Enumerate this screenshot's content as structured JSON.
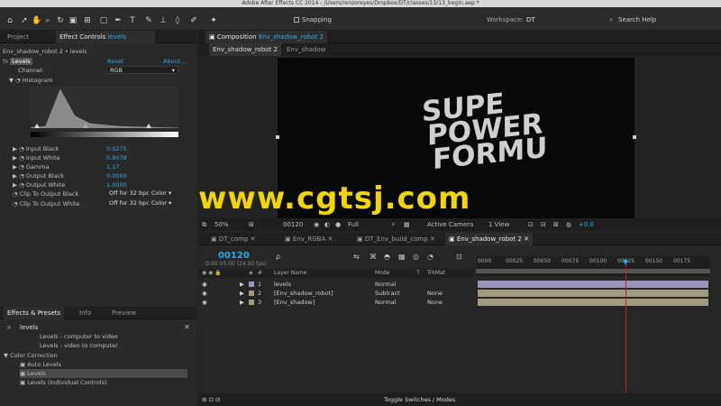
{
  "window_title": "Adobe After Effects CC 2014 - /Users/renzoreyes/Dropbox/DT/classes/13/13_begin.aep *",
  "toolbar": {
    "snapping_label": "Snapping",
    "workspace_label": "Workspace:",
    "workspace_value": "DT",
    "search_help_placeholder": "Search Help"
  },
  "project_panel": {
    "tab_project": "Project",
    "tab_effect_controls": "Effect Controls",
    "tab_effect_controls_layer": "levels",
    "header": "Env_shadow_robot 2 • levels",
    "effect_name": "Levels",
    "reset_label": "Reset",
    "about_label": "About...",
    "channel_label": "Channel:",
    "channel_value": "RGB",
    "histogram_label": "Histogram",
    "properties": [
      {
        "label": "Input Black",
        "value": "0.0275"
      },
      {
        "label": "Input White",
        "value": "0.8078"
      },
      {
        "label": "Gamma",
        "value": "1.17"
      },
      {
        "label": "Output Black",
        "value": "0.0000"
      },
      {
        "label": "Output White",
        "value": "1.0000"
      }
    ],
    "clip_black_label": "Clip To Output Black",
    "clip_black_value": "Off for 32 bpc Color",
    "clip_white_label": "Clip To Output White",
    "clip_white_value": "Off for 32 bpc Color"
  },
  "effects_presets": {
    "tab_effects": "Effects & Presets",
    "tab_info": "Info",
    "tab_preview": "Preview",
    "search_value": "levels",
    "items": [
      "Levels - computer to video",
      "Levels - video to computer"
    ],
    "category": "Color Correction",
    "category_items": [
      "Auto Levels",
      "Levels",
      "Levels (Individual Controls)"
    ]
  },
  "composition": {
    "tab_label": "Composition",
    "tab_comp_name": "Env_shadow_robot 2",
    "sub_tab_active": "Env_shadow_robot 2",
    "sub_tab_other": "Env_shadow",
    "canvas_text": [
      "SUPE",
      "POWER",
      "FORMU"
    ],
    "footer_zoom": "50%",
    "footer_timecode": "00120",
    "footer_resolution": "Full",
    "footer_camera": "Active Camera",
    "footer_view": "1 View",
    "footer_exposure": "+0.0"
  },
  "watermark": "www.cgtsj.com",
  "timeline": {
    "tabs": [
      "DT_comp",
      "Env_RGBA",
      "DT_Env_build_comp",
      "Env_shadow_robot 2"
    ],
    "timecode": "00120",
    "timecode_sub": "0:00:05:00 (24.00 fps)",
    "search_placeholder": "ρ",
    "col_layer_name": "Layer Name",
    "col_mode": "Mode",
    "col_t": "T",
    "col_trkmat": "TrkMat",
    "ruler_ticks": [
      "0000",
      "00025",
      "00050",
      "00075",
      "00100",
      "00125",
      "00150",
      "00175"
    ],
    "layers": [
      {
        "num": "1",
        "name": "levels",
        "mode": "Normal",
        "trkmat": ""
      },
      {
        "num": "2",
        "name": "[Env_shadow_robot]",
        "mode": "Subtract",
        "trkmat": "None"
      },
      {
        "num": "3",
        "name": "[Env_shadow]",
        "mode": "Normal",
        "trkmat": "None"
      }
    ],
    "toggle_label": "Toggle Switches / Modes"
  },
  "colors": {
    "accent": "#35a6e0",
    "watermark": "#f2d600",
    "playhead": "#b8232a",
    "layer_purple": "#9a93b8",
    "layer_tan": "#a39a84"
  },
  "chart_data": {
    "type": "area",
    "title": "",
    "x": [
      0,
      1,
      2,
      3,
      4,
      5,
      6,
      7,
      8,
      9,
      10
    ],
    "values": [
      0.02,
      0.05,
      0.95,
      0.3,
      0.12,
      0.08,
      0.05,
      0.04,
      0.03,
      0.02,
      0.01
    ]
  }
}
